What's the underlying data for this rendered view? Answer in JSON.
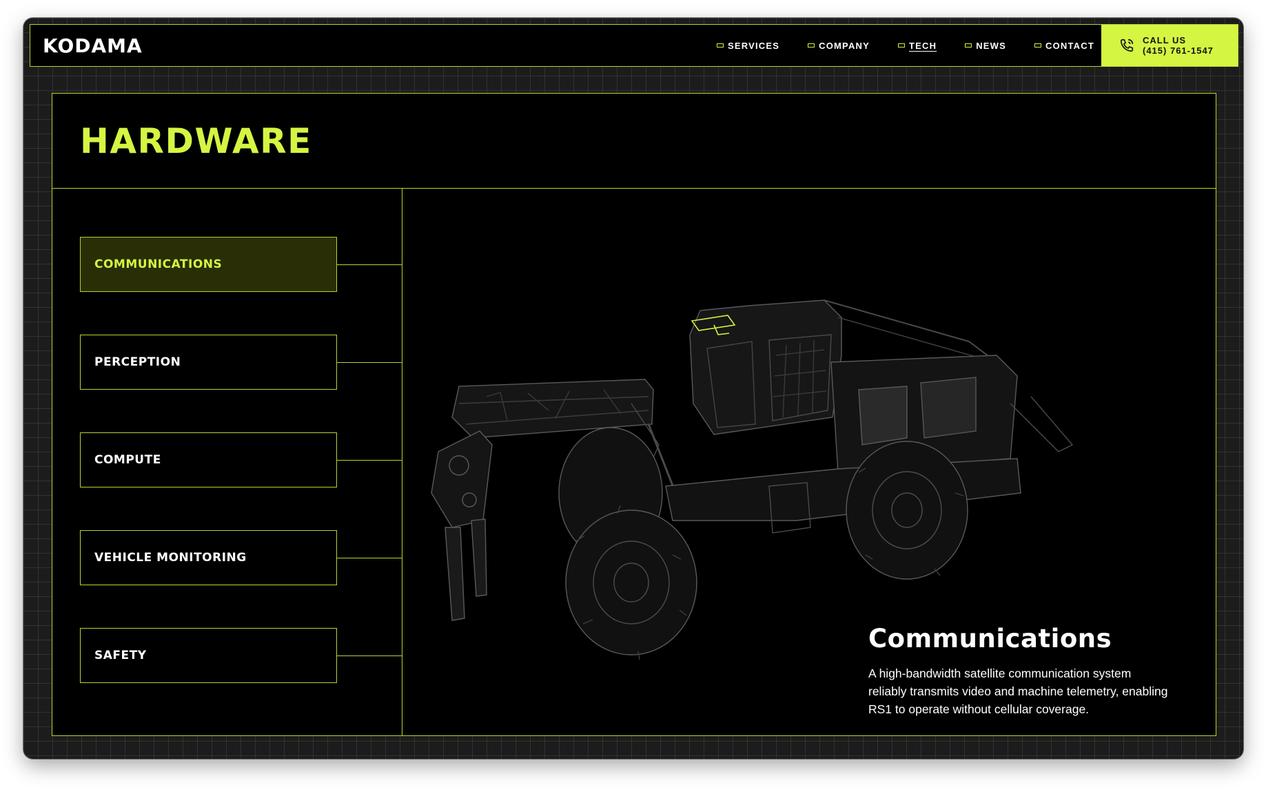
{
  "header": {
    "logo": "KODAMA",
    "nav": [
      {
        "label": "SERVICES"
      },
      {
        "label": "COMPANY"
      },
      {
        "label": "TECH"
      },
      {
        "label": "NEWS"
      },
      {
        "label": "CONTACT"
      }
    ],
    "active_nav": "TECH",
    "call": {
      "label": "CALL US",
      "phone": "(415) 761-1547"
    }
  },
  "section": {
    "title": "HARDWARE",
    "items": [
      {
        "label": "COMMUNICATIONS"
      },
      {
        "label": "PERCEPTION"
      },
      {
        "label": "COMPUTE"
      },
      {
        "label": "VEHICLE MONITORING"
      },
      {
        "label": "SAFETY"
      }
    ],
    "active_item": "COMMUNICATIONS"
  },
  "detail": {
    "title": "Communications",
    "description": "A high-bandwidth satellite communication system reliably transmits video and machine telemetry, enabling RS1 to operate without cellular coverage."
  },
  "colors": {
    "accent": "#d4f542",
    "border": "#b6d532",
    "background": "#000000",
    "frame": "#1d1c1c"
  },
  "icons": [
    "phone-icon",
    "nav-bullet-icon",
    "vehicle-wireframe-image"
  ]
}
